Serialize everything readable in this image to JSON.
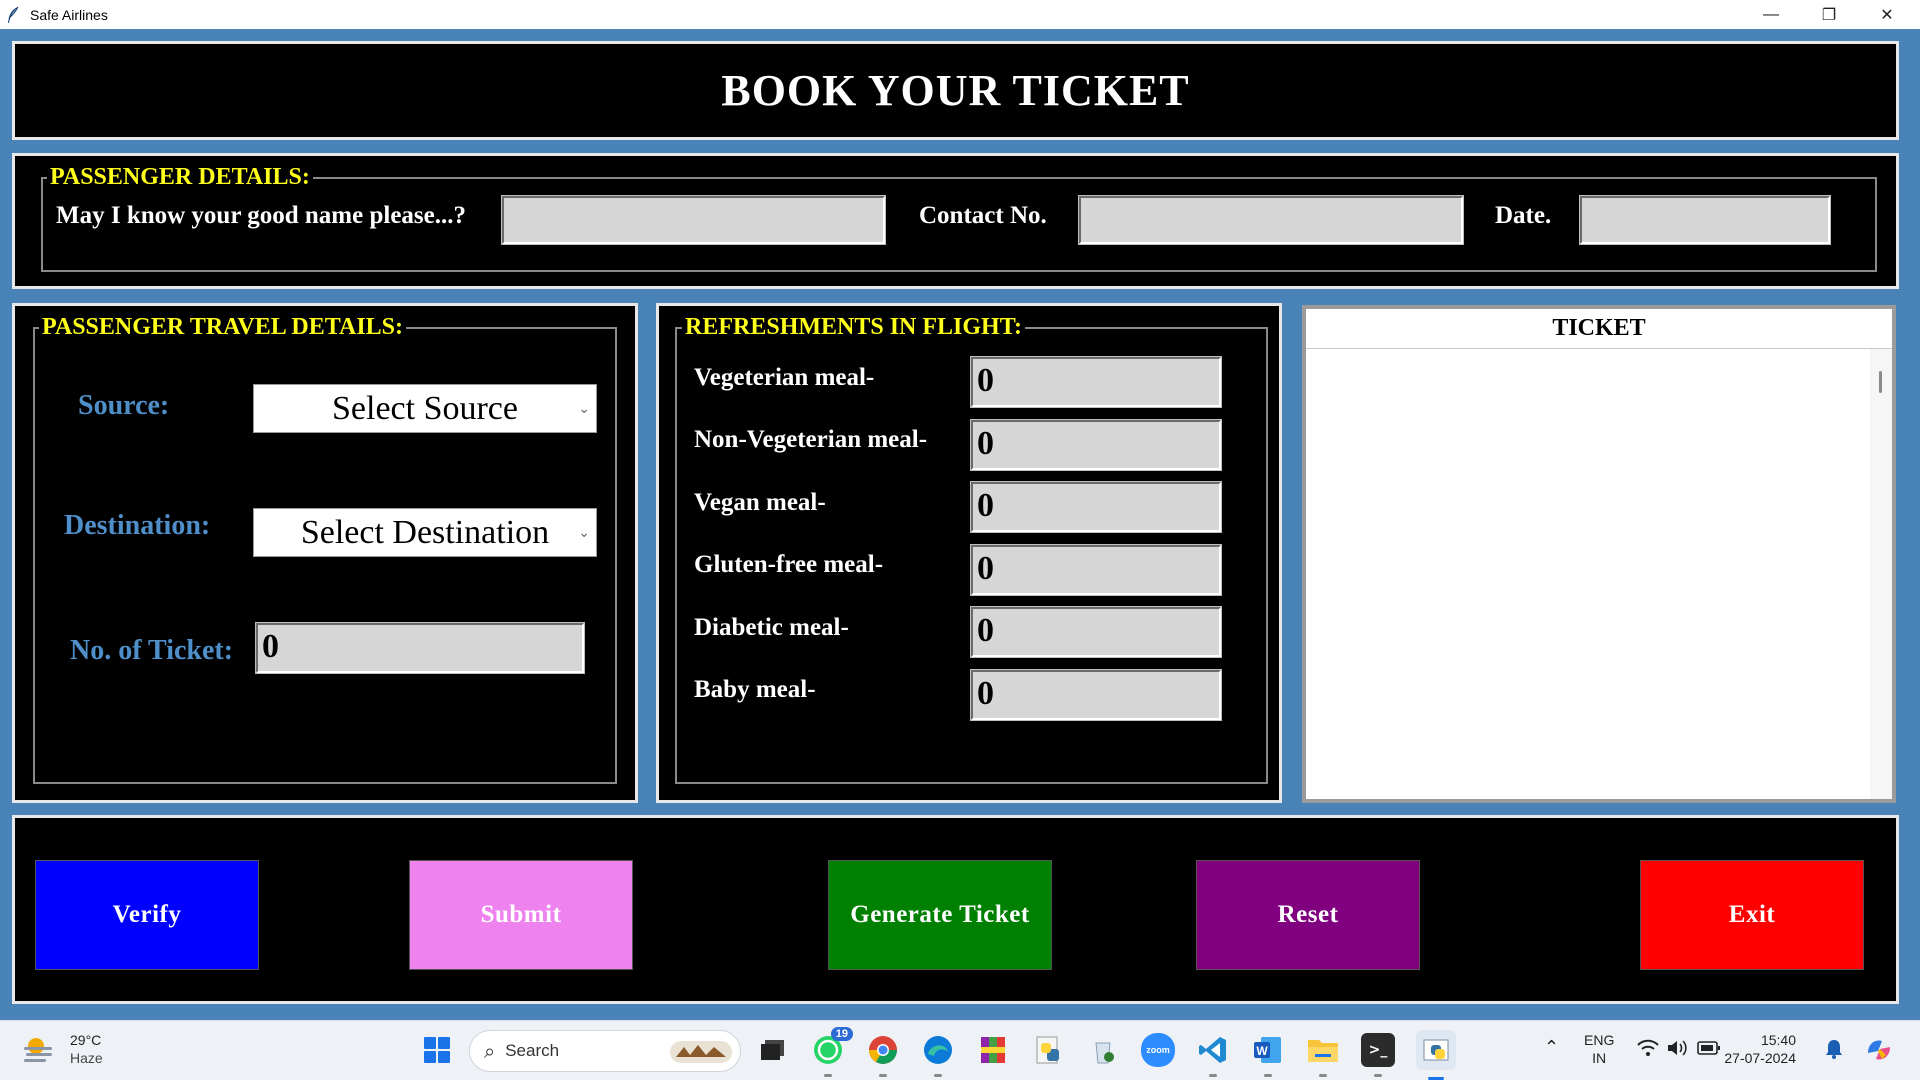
{
  "window": {
    "title": "Safe Airlines",
    "minimize": "—",
    "restore": "❐",
    "close": "✕"
  },
  "header": {
    "title": "BOOK YOUR TICKET"
  },
  "passenger_details": {
    "legend": "PASSENGER DETAILS:",
    "name_label": "May I know your good name please...?",
    "name_value": "",
    "contact_label": "Contact No.",
    "contact_value": "",
    "date_label": "Date.",
    "date_value": ""
  },
  "travel_details": {
    "legend": "PASSENGER TRAVEL DETAILS:",
    "source_label": "Source:",
    "source_value": "Select Source",
    "destination_label": "Destination:",
    "destination_value": "Select Destination",
    "tickets_label": "No. of Ticket:",
    "tickets_value": "0"
  },
  "refreshments": {
    "legend": "REFRESHMENTS IN FLIGHT:",
    "items": [
      {
        "label": "Vegeterian meal-",
        "value": "0"
      },
      {
        "label": "Non-Vegeterian meal-",
        "value": "0"
      },
      {
        "label": "Vegan meal-",
        "value": "0"
      },
      {
        "label": "Gluten-free meal-",
        "value": "0"
      },
      {
        "label": "Diabetic meal-",
        "value": "0"
      },
      {
        "label": "Baby meal-",
        "value": "0"
      }
    ]
  },
  "ticket": {
    "title": "TICKET",
    "content": ""
  },
  "buttons": {
    "verify": "Verify",
    "submit": "Submit",
    "generate": "Generate Ticket",
    "reset": "Reset",
    "exit": "Exit"
  },
  "colors": {
    "background": "#4a83b8",
    "legend": "#ffff1a",
    "verify": "#0000ff",
    "submit": "#ee82ee",
    "generate": "#008000",
    "reset": "#800080",
    "exit": "#ff0000"
  },
  "taskbar": {
    "weather_temp": "29°C",
    "weather_desc": "Haze",
    "search_placeholder": "Search",
    "whatsapp_badge": "19",
    "language": "ENG",
    "region": "IN",
    "time": "15:40",
    "date": "27-07-2024",
    "icons": [
      "windows-start-icon",
      "task-view-icon",
      "whatsapp-icon",
      "chrome-icon",
      "edge-icon",
      "winrar-icon",
      "python-idle-icon",
      "recycle-icon",
      "zoom-icon",
      "vscode-icon",
      "word-icon",
      "file-explorer-icon",
      "terminal-icon",
      "python-app-icon"
    ]
  }
}
